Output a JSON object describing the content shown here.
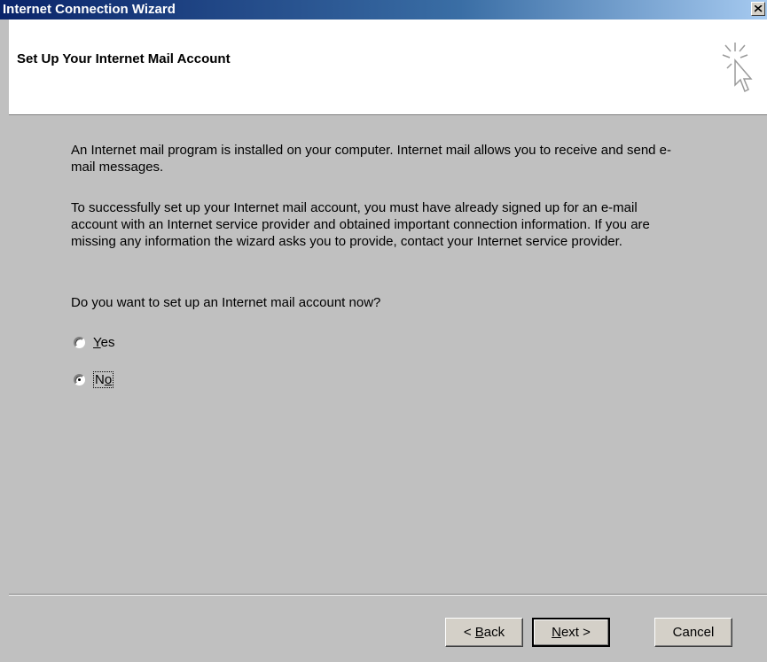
{
  "window": {
    "title": "Internet Connection Wizard",
    "close_label": "×"
  },
  "header": {
    "title": "Set Up Your Internet Mail Account",
    "icon": "wizard-cursor-icon"
  },
  "content": {
    "paragraph1": "An Internet mail program is installed on your computer. Internet mail allows you to receive and send e-mail messages.",
    "paragraph2": "To successfully set up your Internet mail account, you must have already signed up for an e-mail account with an Internet service provider and obtained important connection information. If you are missing any information the wizard asks you to provide, contact your Internet service provider.",
    "question": "Do you want to set up an Internet mail account now?",
    "options": [
      {
        "label": "Yes",
        "selected": false
      },
      {
        "label": "No",
        "selected": true
      }
    ]
  },
  "buttons": {
    "back": "< Back",
    "next": "Next >",
    "cancel": "Cancel"
  }
}
